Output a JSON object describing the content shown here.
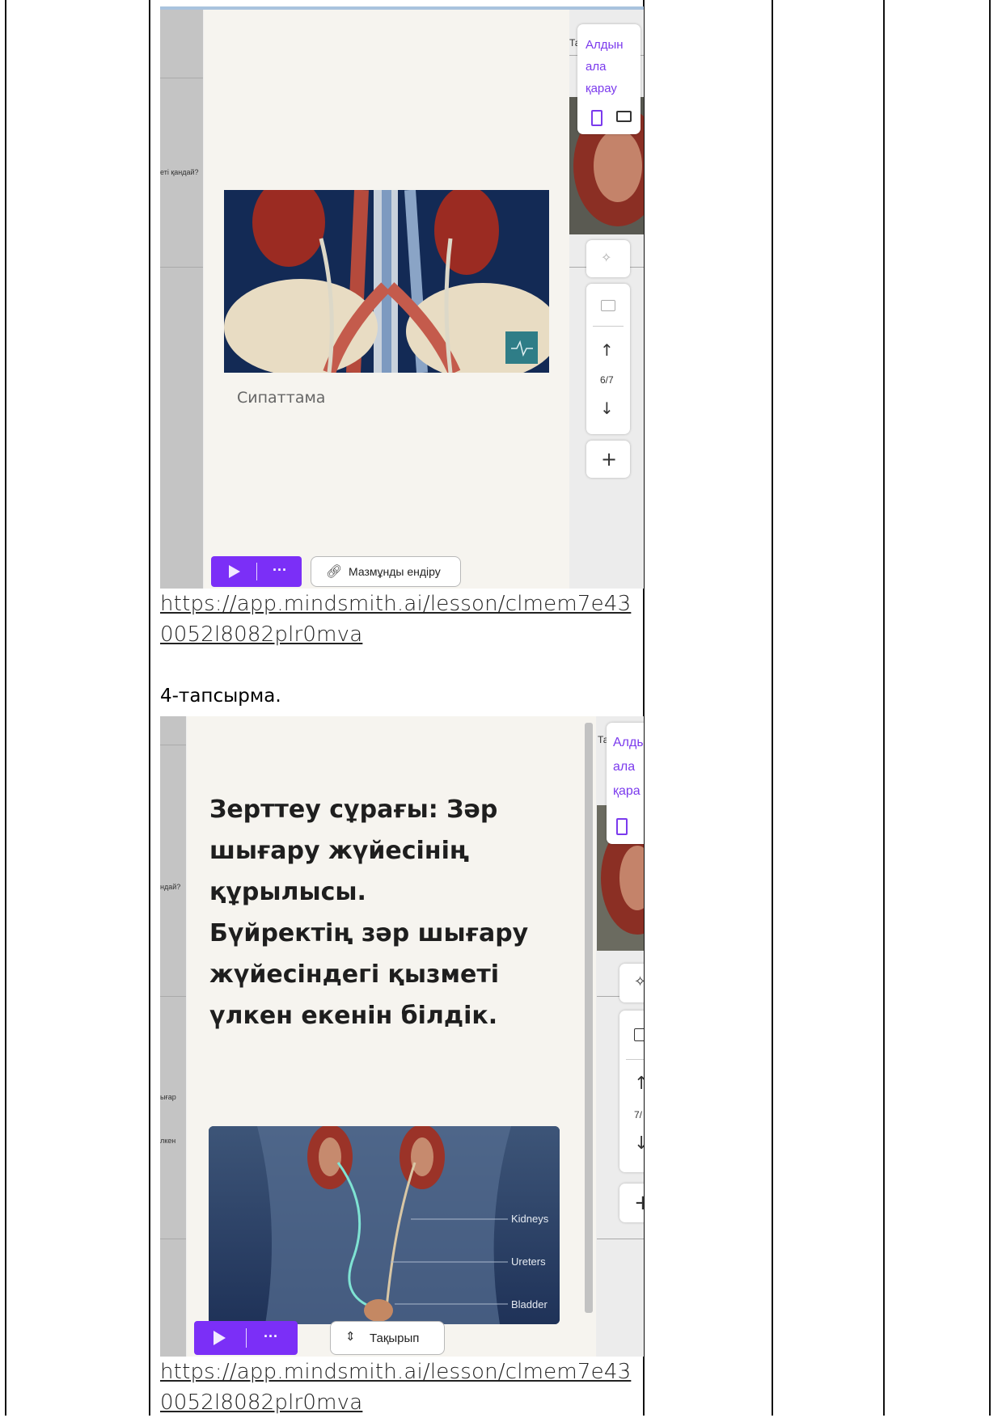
{
  "screenshot1": {
    "preview_label_lines": [
      "Алдын",
      "ала",
      "қарау"
    ],
    "left_cut_text": "еті қандай?",
    "description_placeholder": "Сипаттама",
    "page_counter": "6/7",
    "content_button": "Мазмұнды ендіру",
    "more_label": "···"
  },
  "link1": {
    "line1": "https://app.mindsmith.ai/lesson/clmem7e43",
    "line2": "0052l8082plr0mva"
  },
  "task_label": "4-тапсырма.",
  "screenshot2": {
    "preview_label_lines": [
      "Алды",
      "ала",
      "қара"
    ],
    "left_cut_text_top": "ндай?",
    "left_cut_text_mid1": "ығар",
    "left_cut_text_mid2": "лкен",
    "slide_text_lines": [
      "Зерттеу сұрағы: Зәр",
      "шығару жүйесінің",
      "құрылысы.",
      "Бүйректің зәр шығару",
      "жүйесіндегі қызметі",
      "үлкен екенін білдік."
    ],
    "image_labels": [
      "Kidneys",
      "Ureters",
      "Bladder"
    ],
    "page_counter": "7/",
    "title_button": "Тақырып",
    "more_label": "···"
  },
  "link2": {
    "line1": "https://app.mindsmith.ai/lesson/clmem7e43",
    "line2": "0052l8082plr0mva"
  }
}
